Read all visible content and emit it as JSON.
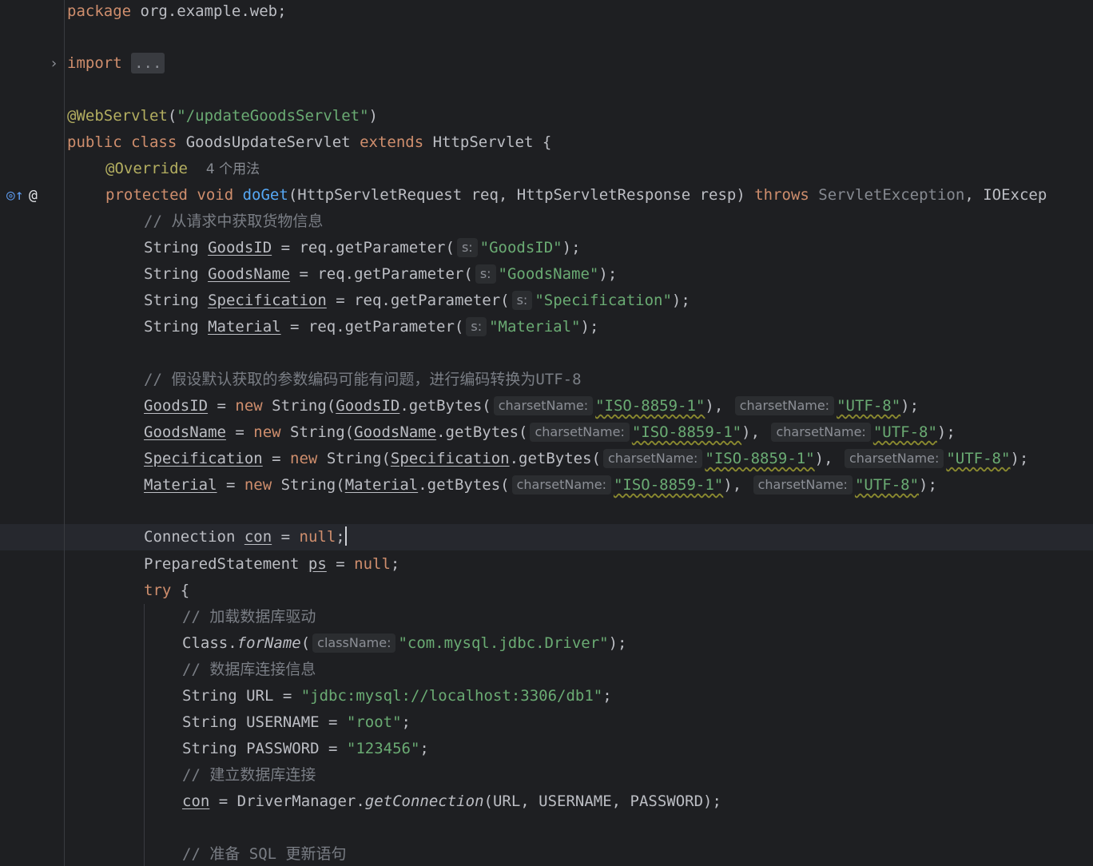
{
  "gutter": {
    "fold_chevron": "›",
    "override_icon": "◎↑",
    "at_icon": "@"
  },
  "code": {
    "l1": {
      "kw": "package",
      "rest": " org.example.web;"
    },
    "l3": {
      "kw": "import",
      "fold": "..."
    },
    "l5": {
      "ann": "@WebServlet",
      "p1": "(",
      "str": "\"/updateGoodsServlet\"",
      "p2": ")"
    },
    "l6": {
      "kw1": "public class",
      "name": " GoodsUpdateServlet ",
      "kw2": "extends",
      "rest": " HttpServlet {"
    },
    "l7": {
      "ann": "@Override",
      "usages": "4 个用法"
    },
    "l8": {
      "kw1": "protected void",
      "fn": "doGet",
      "args": "(HttpServletRequest req, HttpServletResponse resp) ",
      "kw2": "throws",
      "ex1": " ServletException",
      "ex2": ", IOExcep"
    },
    "l9": {
      "comment": "// 从请求中获取货物信息"
    },
    "l10": {
      "type": "String ",
      "var": "GoodsID",
      "call": " = req.getParameter(",
      "hint": "s:",
      "str": "\"GoodsID\"",
      "end": ");"
    },
    "l11": {
      "type": "String ",
      "var": "GoodsName",
      "call": " = req.getParameter(",
      "hint": "s:",
      "str": "\"GoodsName\"",
      "end": ");"
    },
    "l12": {
      "type": "String ",
      "var": "Specification",
      "call": " = req.getParameter(",
      "hint": "s:",
      "str": "\"Specification\"",
      "end": ");"
    },
    "l13": {
      "type": "String ",
      "var": "Material",
      "call": " = req.getParameter(",
      "hint": "s:",
      "str": "\"Material\"",
      "end": ");"
    },
    "l15": {
      "comment": "// 假设默认获取的参数编码可能有问题，进行编码转换为UTF-8"
    },
    "l16": {
      "var": "GoodsID",
      "eq": " = ",
      "kw": "new",
      "ctor": " String(",
      "var2": "GoodsID",
      "call": ".getBytes(",
      "hint1": "charsetName:",
      "str1": "\"ISO-8859-1\"",
      "mid": "), ",
      "hint2": "charsetName:",
      "str2": "\"UTF-8\"",
      "end": ");"
    },
    "l17": {
      "var": "GoodsName",
      "eq": " = ",
      "kw": "new",
      "ctor": " String(",
      "var2": "GoodsName",
      "call": ".getBytes(",
      "hint1": "charsetName:",
      "str1": "\"ISO-8859-1\"",
      "mid": "), ",
      "hint2": "charsetName:",
      "str2": "\"UTF-8\"",
      "end": ");"
    },
    "l18": {
      "var": "Specification",
      "eq": " = ",
      "kw": "new",
      "ctor": " String(",
      "var2": "Specification",
      "call": ".getBytes(",
      "hint1": "charsetName:",
      "str1": "\"ISO-8859-1\"",
      "mid": "), ",
      "hint2": "charsetName:",
      "str2": "\"UTF-8\"",
      "end": ");"
    },
    "l19": {
      "var": "Material",
      "eq": " = ",
      "kw": "new",
      "ctor": " String(",
      "var2": "Material",
      "call": ".getBytes(",
      "hint1": "charsetName:",
      "str1": "\"ISO-8859-1\"",
      "mid": "), ",
      "hint2": "charsetName:",
      "str2": "\"UTF-8\"",
      "end": ");"
    },
    "l21": {
      "type": "Connection ",
      "var": "con",
      "eq": " = ",
      "kw": "null",
      "end": ";"
    },
    "l22": {
      "type": "PreparedStatement ",
      "var": "ps",
      "eq": " = ",
      "kw": "null",
      "end": ";"
    },
    "l23": {
      "kw": "try",
      "rest": " {"
    },
    "l24": {
      "comment": "// 加载数据库驱动"
    },
    "l25": {
      "cls": "Class.",
      "method": "forName",
      "p1": "(",
      "hint": "className:",
      "str": "\"com.mysql.jdbc.Driver\"",
      "end": ");"
    },
    "l26": {
      "comment": "// 数据库连接信息"
    },
    "l27": {
      "decl": "String URL = ",
      "str": "\"jdbc:mysql://localhost:3306/db1\"",
      "end": ";"
    },
    "l28": {
      "decl": "String USERNAME = ",
      "str": "\"root\"",
      "end": ";"
    },
    "l29": {
      "decl": "String PASSWORD = ",
      "str": "\"123456\"",
      "end": ";"
    },
    "l30": {
      "comment": "// 建立数据库连接"
    },
    "l31": {
      "var": "con",
      "eq": " = DriverManager.",
      "method": "getConnection",
      "rest": "(URL, USERNAME, PASSWORD);"
    },
    "l33": {
      "comment": "// 准备 SQL 更新语句"
    }
  }
}
